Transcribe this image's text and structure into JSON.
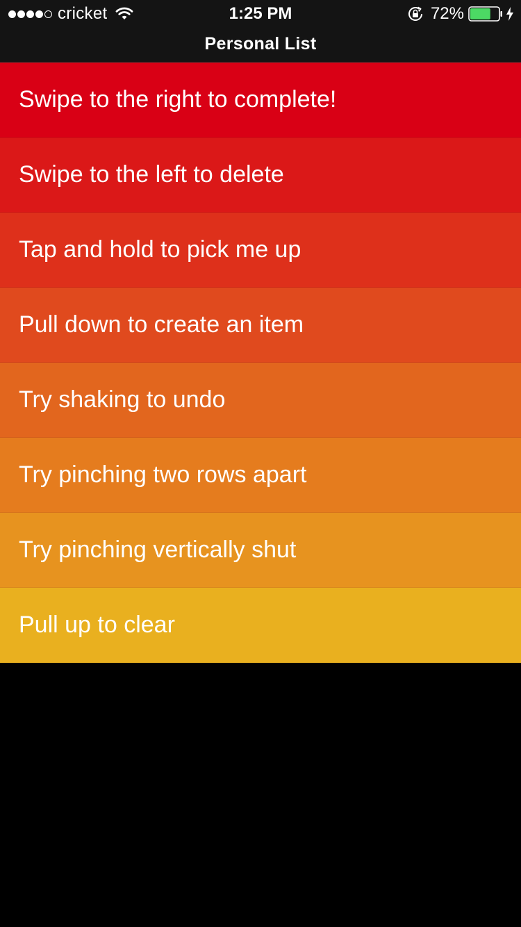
{
  "status_bar": {
    "carrier": "cricket",
    "signal_bars": 4,
    "signal_total": 5,
    "time": "1:25 PM",
    "battery_percent": "72%",
    "battery_level": 0.72,
    "battery_color": "#4cd964",
    "icons": [
      "wifi-icon",
      "rotation-lock-icon",
      "battery-icon",
      "charging-bolt-icon"
    ]
  },
  "nav": {
    "title": "Personal List"
  },
  "list": {
    "items": [
      {
        "label": "Swipe to the right to complete!",
        "color": "#d90015"
      },
      {
        "label": "Swipe to the left to delete",
        "color": "#db1818"
      },
      {
        "label": "Tap and hold to pick me up",
        "color": "#de301b"
      },
      {
        "label": "Pull down to create an item",
        "color": "#e04a1e"
      },
      {
        "label": "Try shaking to undo",
        "color": "#e2661e"
      },
      {
        "label": "Try pinching two rows apart",
        "color": "#e57c1e"
      },
      {
        "label": "Try pinching vertically shut",
        "color": "#e7931f"
      },
      {
        "label": "Pull up to clear",
        "color": "#e9b01f"
      }
    ]
  },
  "colors": {
    "background": "#000000",
    "bar_background": "#141414"
  }
}
